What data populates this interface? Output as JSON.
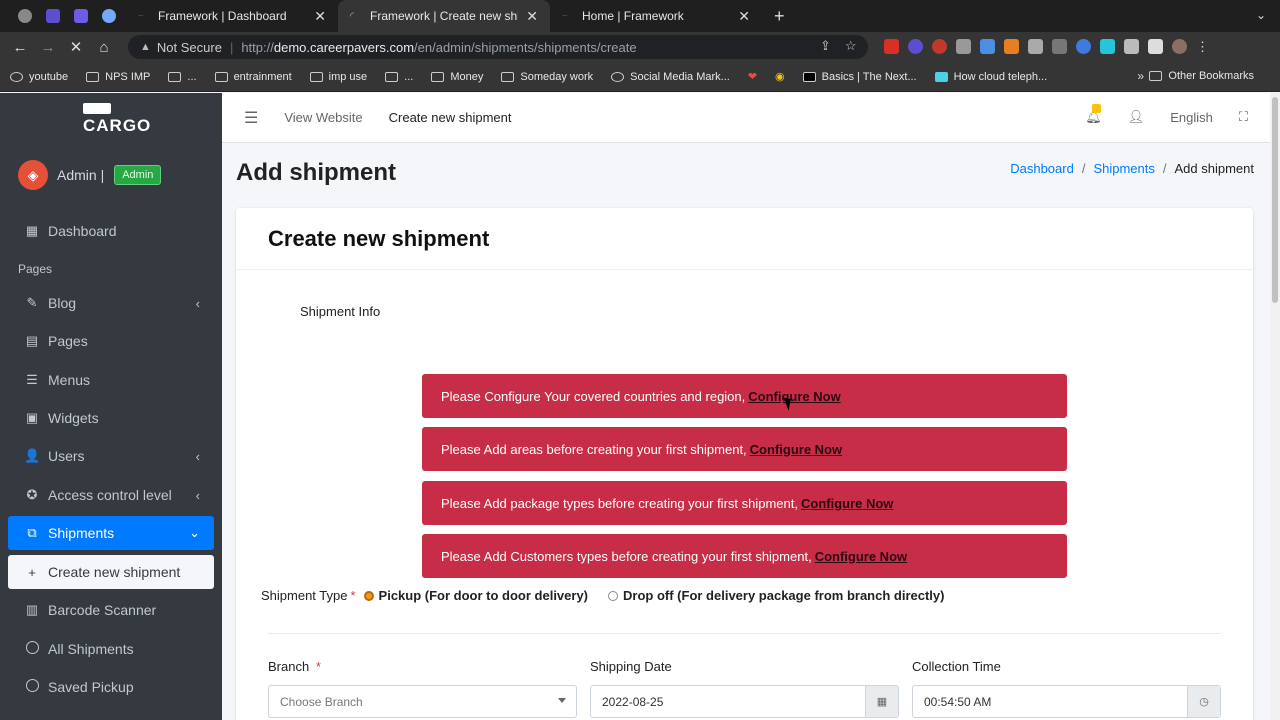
{
  "browser": {
    "tabs": [
      {
        "label": "Framework | Dashboard",
        "active": false
      },
      {
        "label": "Framework | Create new shipm",
        "active": true
      },
      {
        "label": "Home | Framework",
        "active": false
      }
    ],
    "new_tab": "+",
    "address": {
      "warning": "Not Secure",
      "url_prefix": "http://",
      "url_host": "demo.careerpavers.com",
      "url_path": "/en/admin/shipments/shipments/create"
    },
    "bookmarks": [
      "youtube",
      "NPS IMP",
      "...",
      "entrainment",
      "imp use",
      "...",
      "Money",
      "Someday work",
      "Social Media Mark...",
      "Basics | The Next...",
      "How cloud teleph..."
    ],
    "bookmarks_more": "»",
    "other_bookmarks": "Other Bookmarks"
  },
  "sidebar": {
    "logo_text": "CARGO",
    "user_name": "Admin |",
    "role_badge": "Admin",
    "section_header": "Pages",
    "items": [
      {
        "label": "Dashboard"
      },
      {
        "label": "Blog"
      },
      {
        "label": "Pages"
      },
      {
        "label": "Menus"
      },
      {
        "label": "Widgets"
      },
      {
        "label": "Users"
      },
      {
        "label": "Access control level"
      },
      {
        "label": "Shipments"
      },
      {
        "label": "Create new shipment"
      },
      {
        "label": "Barcode Scanner"
      },
      {
        "label": "All Shipments"
      },
      {
        "label": "Saved Pickup"
      }
    ]
  },
  "topnav": {
    "view_website": "View Website",
    "create_new_shipment": "Create new shipment",
    "notification_count": "0",
    "language": "English"
  },
  "content": {
    "page_title": "Add shipment",
    "breadcrumb": [
      "Dashboard",
      "Shipments",
      "Add shipment"
    ],
    "breadcrumb_sep": "/",
    "card_title": "Create new shipment",
    "section_label": "Shipment Info",
    "alerts": [
      {
        "text": "Please Configure Your covered countries and region,",
        "link": "Configure Now"
      },
      {
        "text": "Please Add areas before creating your first shipment,",
        "link": "Configure Now"
      },
      {
        "text": "Please Add package types before creating your first shipment,",
        "link": "Configure Now"
      },
      {
        "text": "Please Add Customers types before creating your first shipment,",
        "link": "Configure Now"
      }
    ],
    "shipment_type": {
      "label": "Shipment Type",
      "required_mark": "*",
      "options": [
        "Pickup (For door to door delivery)",
        "Drop off (For delivery package from branch directly)"
      ],
      "selected": "Pickup (For door to door delivery)"
    },
    "fields": {
      "branch_label": "Branch",
      "branch_required": "*",
      "branch_placeholder": "Choose Branch",
      "shipping_date_label": "Shipping Date",
      "shipping_date_value": "2022-08-25",
      "collection_time_label": "Collection Time",
      "collection_time_value": "00:54:50 AM"
    }
  },
  "colors": {
    "sidebar_bg": "#343a40",
    "primary": "#007bff",
    "alert_bg": "#c82d47",
    "success": "#28a745"
  }
}
